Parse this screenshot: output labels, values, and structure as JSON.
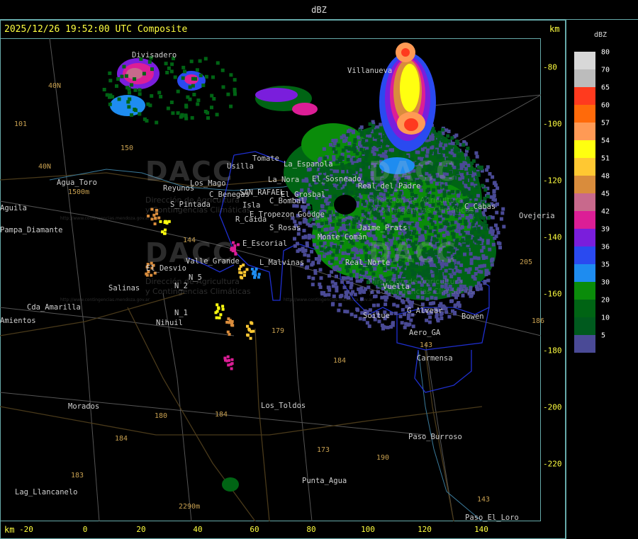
{
  "window": {
    "title": "dBZ"
  },
  "header": {
    "timestamp": "2025/12/26 19:52:00 UTC Composite",
    "km_label_top": "km",
    "km_label_bottom": "km"
  },
  "axes": {
    "x_ticks": [
      "-20",
      "0",
      "20",
      "40",
      "60",
      "80",
      "100",
      "120",
      "140"
    ],
    "y_ticks": [
      "-80",
      "-100",
      "-120",
      "-140",
      "-160",
      "-180",
      "-200",
      "-220"
    ]
  },
  "legend": {
    "title": "dBZ",
    "levels": [
      {
        "label": "80",
        "color": "#d8d8d8"
      },
      {
        "label": "70",
        "color": "#bcbcbc"
      },
      {
        "label": "65",
        "color": "#ff3a1e"
      },
      {
        "label": "60",
        "color": "#ff6a0a"
      },
      {
        "label": "57",
        "color": "#ff9a55"
      },
      {
        "label": "54",
        "color": "#ffff10"
      },
      {
        "label": "51",
        "color": "#ffc832"
      },
      {
        "label": "48",
        "color": "#d98c3c"
      },
      {
        "label": "45",
        "color": "#c8698c"
      },
      {
        "label": "42",
        "color": "#dc1e96"
      },
      {
        "label": "39",
        "color": "#7a1edc"
      },
      {
        "label": "36",
        "color": "#2a4af0"
      },
      {
        "label": "35",
        "color": "#1e8cf0"
      },
      {
        "label": "30",
        "color": "#0a8c0a"
      },
      {
        "label": "20",
        "color": "#006414"
      },
      {
        "label": "10",
        "color": "#005a1e"
      },
      {
        "label": "5",
        "color": "#4a4a96"
      }
    ]
  },
  "places": [
    "Divisadero",
    "Villanueva",
    "Usilla",
    "Tomate",
    "La_Espanola",
    "La_Nora",
    "Reyunos",
    "Los_Mago",
    "C_Benegas",
    "SAN_RAFAEL",
    "El_Grosbal",
    "C_Bombal",
    "El_Sosneado",
    "S_Pintada",
    "Isla",
    "E_Tropezon",
    "Goudge",
    "Real_del_Padre",
    "R_Caida",
    "S_Rosas",
    "Monte_Comán",
    "C_Cabas",
    "Aguila",
    "Pampa_Diamante",
    "Agua_Toro",
    "E_Escorial",
    "Valle_Grande",
    "L_Malvinas",
    "Real_Norte",
    "El_Desvio",
    "N_5",
    "N_2",
    "Salinas",
    "N_1",
    "Nihuil",
    "Cda_Amarilla",
    "Amientos",
    "Soitue",
    "G_Alvear",
    "Bowen",
    "Aero_GA",
    "Carmensa",
    "Morados",
    "Los_Toldos",
    "Paso_Burroso",
    "Punta_Agua",
    "Lag_Llancanelo",
    "Paso_El_Loro",
    "Vuelta",
    "Ovejeria",
    "Jaime_Prats"
  ],
  "routes": [
    "40N",
    "40N",
    "101",
    "150",
    "144",
    "179",
    "184",
    "180",
    "184",
    "183",
    "184",
    "190",
    "143",
    "143",
    "205",
    "173",
    "186"
  ],
  "elevation_labels": [
    "1500m",
    "2290m"
  ],
  "watermark": {
    "brand": "DACC",
    "line1": "Dirección de Agricultura",
    "line2": "y Contingencias Climáticas",
    "url": "http://www.contingencias.mendoza.gov.ar"
  }
}
